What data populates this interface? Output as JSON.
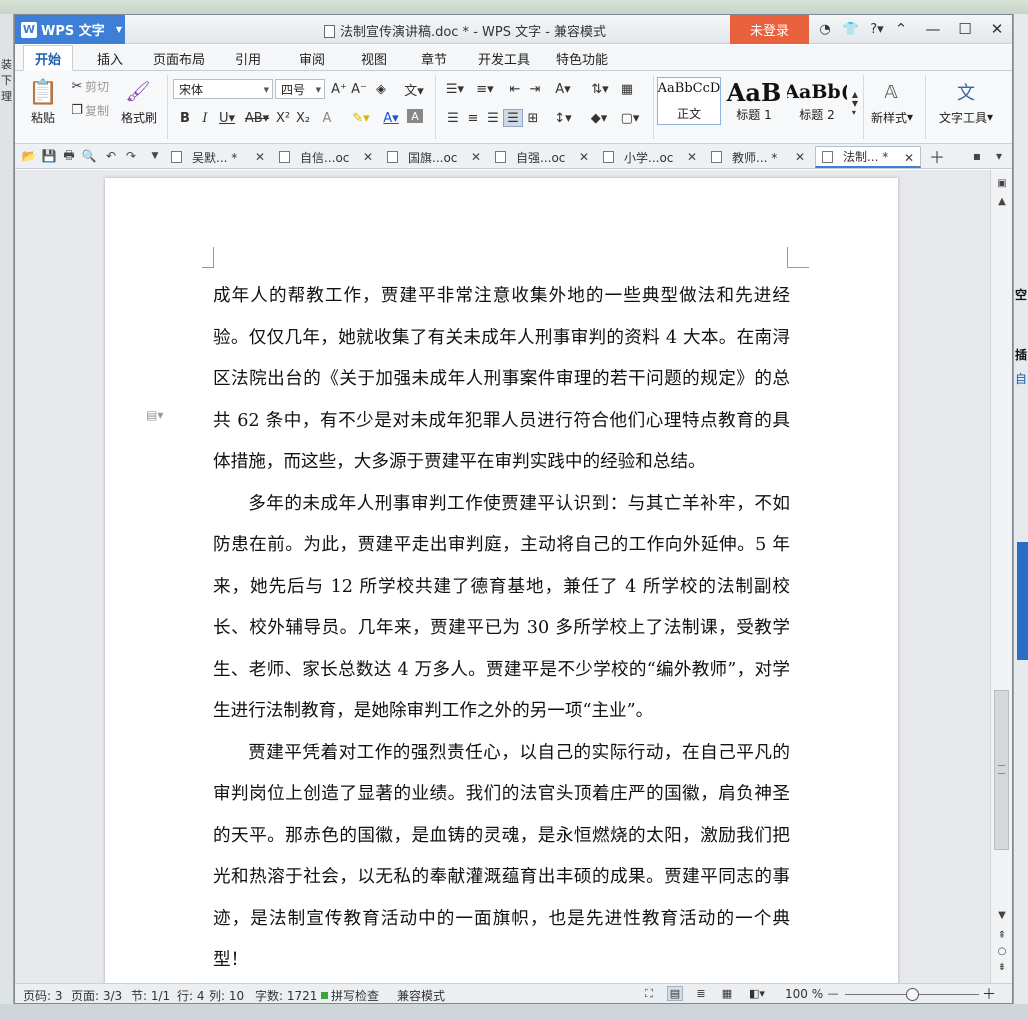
{
  "window": {
    "app_button": "WPS 文字",
    "doc_title": "法制宣传演讲稿.doc * - WPS 文字 - 兼容模式",
    "login_button": "未登录"
  },
  "ribbon_tabs": [
    "开始",
    "插入",
    "页面布局",
    "引用",
    "审阅",
    "视图",
    "章节",
    "开发工具",
    "特色功能"
  ],
  "ribbon": {
    "paste": "粘贴",
    "cut": "剪切",
    "copy": "复制",
    "format_painter": "格式刷",
    "font_name": "宋体",
    "font_size": "四号",
    "styles": [
      {
        "sample": "AaBbCcD",
        "label": "正文"
      },
      {
        "sample": "AaB",
        "label": "标题 1"
      },
      {
        "sample": "AaBb(",
        "label": "标题 2"
      }
    ],
    "new_style": "新样式",
    "text_tools": "文字工具"
  },
  "doc_tabs": [
    {
      "label": "吴默... *",
      "active": false
    },
    {
      "label": "自信...oc",
      "active": false
    },
    {
      "label": "国旗...oc",
      "active": false
    },
    {
      "label": "自强...oc",
      "active": false
    },
    {
      "label": "小学...oc",
      "active": false
    },
    {
      "label": "教师... *",
      "active": false
    },
    {
      "label": "法制... *",
      "active": true
    }
  ],
  "document": {
    "paragraphs": [
      {
        "indent": false,
        "text": "成年人的帮教工作，贾建平非常注意收集外地的一些典型做法和先进经验。仅仅几年，她就收集了有关未成年人刑事审判的资料 4 大本。在南浔区法院出台的《关于加强未成年人刑事案件审理的若干问题的规定》的总共 62 条中，有不少是对未成年犯罪人员进行符合他们心理特点教育的具体措施，而这些，大多源于贾建平在审判实践中的经验和总结。"
      },
      {
        "indent": true,
        "text": "多年的未成年人刑事审判工作使贾建平认识到：与其亡羊补牢，不如防患在前。为此，贾建平走出审判庭，主动将自己的工作向外延伸。5 年来，她先后与 12 所学校共建了德育基地，兼任了 4 所学校的法制副校长、校外辅导员。几年来，贾建平已为 30 多所学校上了法制课，受教学生、老师、家长总数达 4 万多人。贾建平是不少学校的“编外教师”，对学生进行法制教育，是她除审判工作之外的另一项“主业”。"
      },
      {
        "indent": true,
        "text": "贾建平凭着对工作的强烈责任心，以自己的实际行动，在自己平凡的审判岗位上创造了显著的业绩。我们的法官头顶着庄严的国徽，肩负神圣的天平。那赤色的国徽，是血铸的灵魂，是永恒燃烧的太阳，激励我们把光和热溶于社会，以无私的奉献灌溉蕴育出丰硕的成果。贾建平同志的事迹，是法制宣传教育活动中的一面旗帜，也是先进性教育活动的一个典型！"
      }
    ]
  },
  "status": {
    "page_num": "页码: 3",
    "pages": "页面: 3/3",
    "section": "节: 1/1",
    "row": "行: 4",
    "col": "列: 10",
    "words": "字数: 1721",
    "spell": "拼写检查",
    "compat": "兼容模式",
    "zoom": "100 %"
  },
  "desktop_fragments": {
    "left": [
      "装下",
      "理"
    ],
    "right": [
      "空",
      "插",
      "自"
    ]
  }
}
